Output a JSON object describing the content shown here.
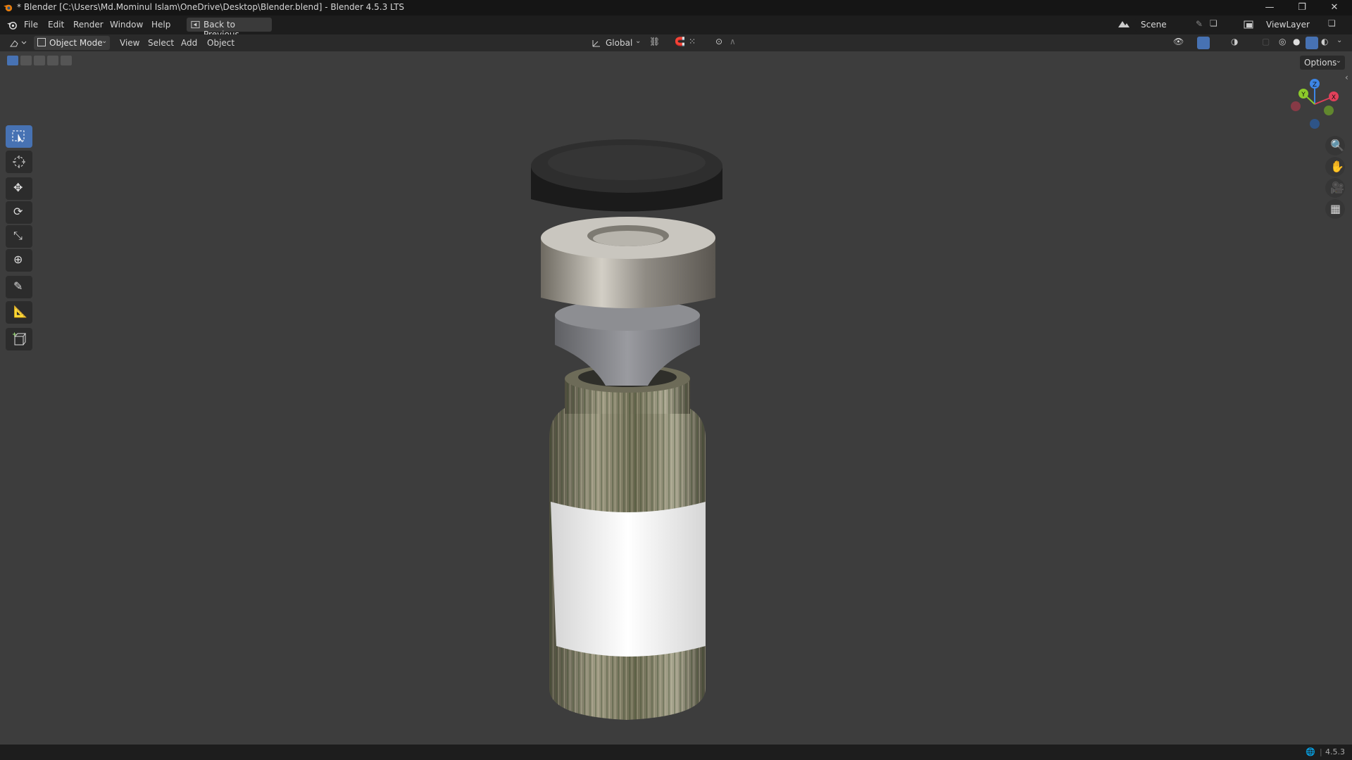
{
  "window": {
    "title": "* Blender [C:\\Users\\Md.Mominul Islam\\OneDrive\\Desktop\\Blender.blend] - Blender 4.5.3 LTS",
    "controls": [
      "—",
      "❐",
      "✕"
    ]
  },
  "menubar": {
    "items": [
      "File",
      "Edit",
      "Render",
      "Window",
      "Help"
    ],
    "back_button": "Back to Previous",
    "scene": "Scene",
    "view_layer": "ViewLayer"
  },
  "header": {
    "mode": "Object Mode",
    "menus": [
      "View",
      "Select",
      "Add",
      "Object"
    ],
    "transform_orientation": "Global"
  },
  "viewport": {
    "options_label": "Options",
    "gizmo_axes": [
      "Z",
      "X",
      "Y"
    ],
    "tools": [
      "select-box",
      "cursor",
      "move",
      "rotate",
      "scale",
      "transform",
      "annotate",
      "measure",
      "add-cube"
    ],
    "nav_buttons": [
      "zoom",
      "pan",
      "camera",
      "perspective"
    ]
  },
  "statusbar": {
    "version": "4.5.3"
  },
  "colors": {
    "accent": "#4772b3",
    "background": "#3d3d3d",
    "axis_x": "#e0405a",
    "axis_y": "#8ccb2a",
    "axis_z": "#3d86e6"
  }
}
